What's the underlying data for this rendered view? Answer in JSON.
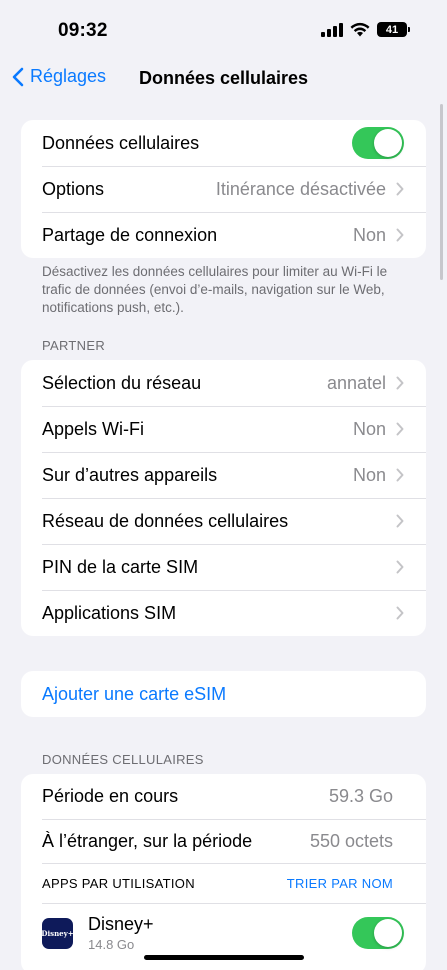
{
  "status_bar": {
    "time": "09:32",
    "battery": "41"
  },
  "nav": {
    "back_label": "Réglages",
    "title": "Données cellulaires"
  },
  "group1": {
    "cellular_data_label": "Données cellulaires",
    "cellular_data_on": true,
    "options_label": "Options",
    "options_value": "Itinérance désactivée",
    "hotspot_label": "Partage de connexion",
    "hotspot_value": "Non"
  },
  "footnote": "Désactivez les données cellulaires pour limiter au Wi-Fi le trafic de données (envoi d’e-mails, navigation sur le Web, notifications push, etc.).",
  "partner": {
    "header": "PARTNER",
    "rows": [
      {
        "label": "Sélection du réseau",
        "value": "annatel"
      },
      {
        "label": "Appels Wi-Fi",
        "value": "Non"
      },
      {
        "label": "Sur d’autres appareils",
        "value": "Non"
      },
      {
        "label": "Réseau de données cellulaires",
        "value": ""
      },
      {
        "label": "PIN de la carte SIM",
        "value": ""
      },
      {
        "label": "Applications SIM",
        "value": ""
      }
    ]
  },
  "esim": {
    "label": "Ajouter une carte eSIM"
  },
  "usage": {
    "header": "DONNÉES CELLULAIRES",
    "current_period_label": "Période en cours",
    "current_period_value": "59.3 Go",
    "abroad_label": "À l’étranger, sur la période",
    "abroad_value": "550 octets",
    "apps_header": "APPS PAR UTILISATION",
    "sort_label": "TRIER PAR NOM",
    "apps": [
      {
        "name": "Disney+",
        "size": "14.8 Go",
        "icon": "disney-plus-icon",
        "icon_text": "Disney+",
        "enabled": true
      }
    ]
  },
  "colors": {
    "accent": "#0a7aff",
    "toggle_on": "#34c759",
    "background": "#f2f2f7"
  }
}
